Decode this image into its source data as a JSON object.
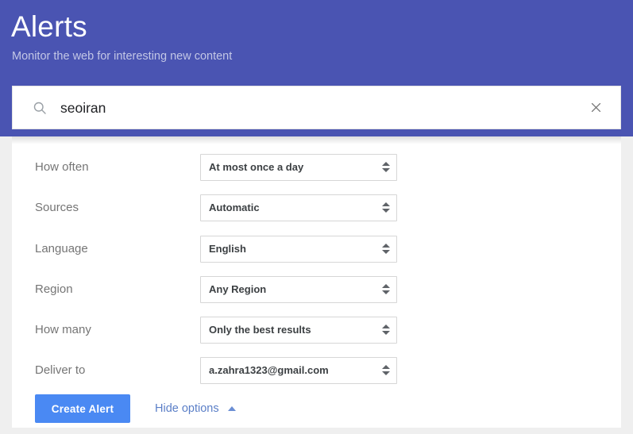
{
  "header": {
    "title": "Alerts",
    "subtitle": "Monitor the web for interesting new content",
    "background_color": "#4a54b2"
  },
  "search": {
    "icon": "search-icon",
    "value": "seoiran",
    "placeholder": "Create an alert about...",
    "clear_icon": "close-icon"
  },
  "options": {
    "rows": [
      {
        "label": "How often",
        "value": "At most once a day",
        "name": "how-often"
      },
      {
        "label": "Sources",
        "value": "Automatic",
        "name": "sources"
      },
      {
        "label": "Language",
        "value": "English",
        "name": "language"
      },
      {
        "label": "Region",
        "value": "Any Region",
        "name": "region"
      },
      {
        "label": "How many",
        "value": "Only the best results",
        "name": "how-many"
      },
      {
        "label": "Deliver to",
        "value": "a.zahra1323@gmail.com",
        "name": "deliver-to"
      }
    ]
  },
  "actions": {
    "create_label": "Create Alert",
    "create_color": "#4a89f3",
    "hide_options_label": "Hide options",
    "hide_options_color": "#5b7fc7",
    "caret_icon": "caret-up-icon"
  }
}
